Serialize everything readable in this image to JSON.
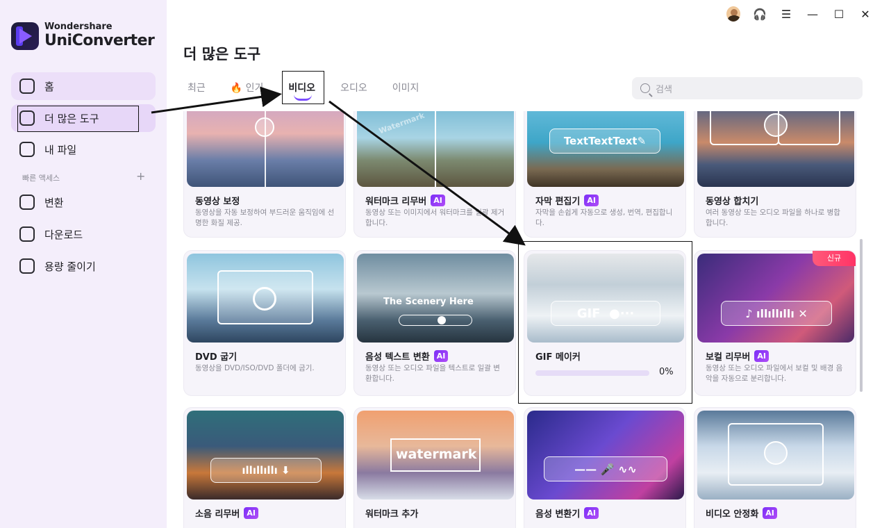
{
  "brand": {
    "top": "Wondershare",
    "bottom": "UniConverter"
  },
  "sidebar": {
    "items": [
      {
        "label": "홈",
        "icon": "home-icon"
      },
      {
        "label": "더 많은 도구",
        "icon": "toolbox-icon"
      },
      {
        "label": "내 파일",
        "icon": "file-icon"
      }
    ],
    "quick_access_label": "빠른 액세스",
    "quick_items": [
      {
        "label": "변환",
        "icon": "convert-icon"
      },
      {
        "label": "다운로드",
        "icon": "download-icon"
      },
      {
        "label": "용량 줄이기",
        "icon": "compress-icon"
      }
    ]
  },
  "header": {
    "title": "더 많은 도구",
    "tabs": [
      "최근",
      "인기",
      "비디오",
      "오디오",
      "이미지"
    ],
    "active_tab": "비디오",
    "search_placeholder": "검색"
  },
  "cards": [
    {
      "title": "동영상 보정",
      "ai": false,
      "desc": "동영상을 자동 보정하여 부드러운 움직임에 선명한 화질 제공."
    },
    {
      "title": "워터마크 리무버",
      "ai": true,
      "desc": "동영상 또는 이미지에서 워터마크를 일괄 제거합니다.",
      "thumb_text": "Watermark"
    },
    {
      "title": "자막 편집기",
      "ai": true,
      "desc": "자막을 손쉽게 자동으로 생성, 번역, 편집합니다.",
      "thumb_text": "TextTextText"
    },
    {
      "title": "동영상 합치기",
      "ai": false,
      "desc": "여러 동영상 또는 오디오 파일을 하나로 병합합니다."
    },
    {
      "title": "DVD 굽기",
      "ai": false,
      "desc": "동영상을 DVD/ISO/DVD 폴더에 굽기."
    },
    {
      "title": "음성 텍스트 변환",
      "ai": true,
      "desc": "동영상 또는 오디오 파일을 텍스트로 일괄 변환합니다.",
      "thumb_text": "The Scenery Here"
    },
    {
      "title": "GIF 메이커",
      "ai": false,
      "progress": 0,
      "progress_label": "0%",
      "thumb_text": "GIF"
    },
    {
      "title": "보컬 리무버",
      "ai": true,
      "desc": "동영상 또는 오디오 파일에서 보컬 및 배경 음악을 자동으로 분리합니다.",
      "badge": "신규"
    },
    {
      "title": "소음 리무버",
      "ai": true
    },
    {
      "title": "워터마크 추가",
      "ai": false,
      "thumb_text": "watermark"
    },
    {
      "title": "음성 변환기",
      "ai": true
    },
    {
      "title": "비디오 안정화",
      "ai": true
    }
  ],
  "ai_label": "AI",
  "colors": {
    "accent": "#7b4dff",
    "sidebar_bg": "#f4eefb",
    "new_badge": "#ff3366"
  }
}
